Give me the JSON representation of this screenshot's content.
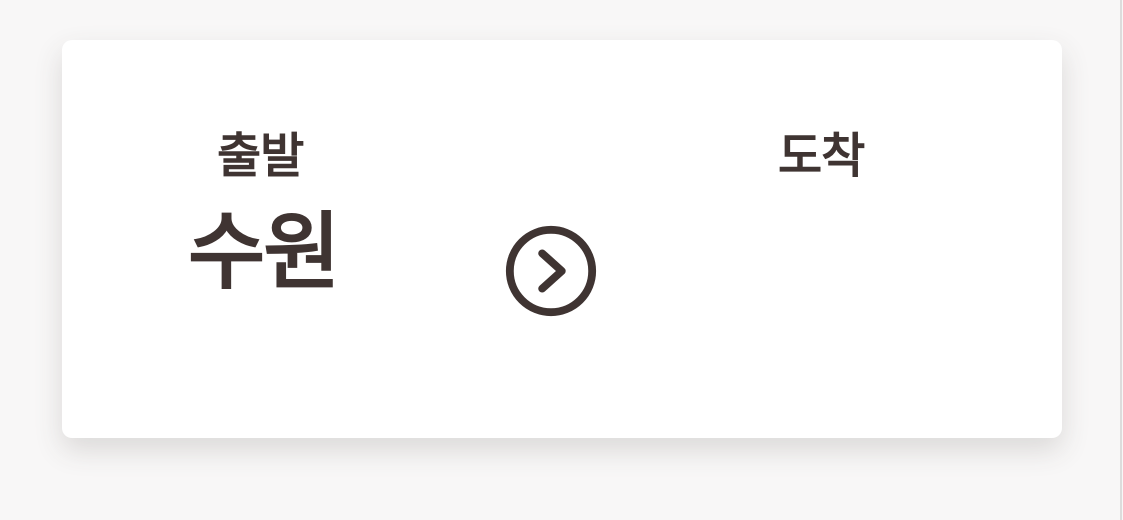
{
  "route": {
    "departure_label": "출발",
    "departure_value": "수원",
    "arrival_label": "도착",
    "arrival_value": ""
  },
  "icons": {
    "swap": "chevron-right-circle-icon"
  },
  "colors": {
    "text": "#3f3432",
    "background": "#f8f7f7",
    "card": "#ffffff"
  }
}
